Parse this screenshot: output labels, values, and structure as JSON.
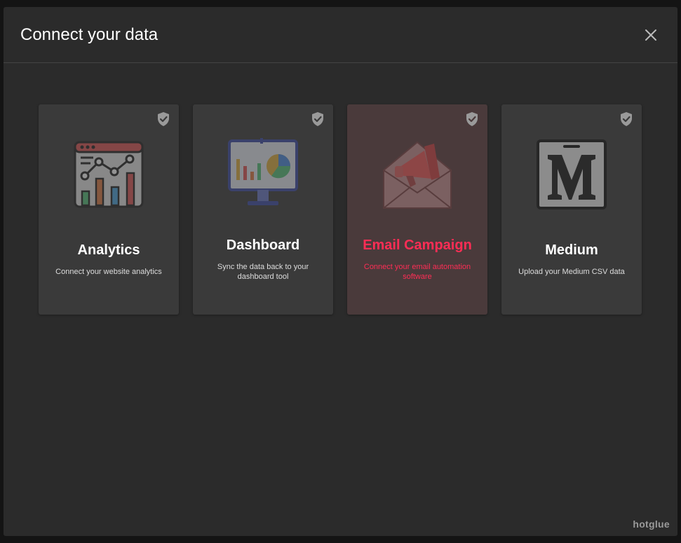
{
  "modal": {
    "title": "Connect your data",
    "close_icon": "close-icon"
  },
  "cards": [
    {
      "title": "Analytics",
      "description": "Connect your website analytics",
      "icon": "analytics-chart-icon",
      "badge_icon": "shield-check-icon",
      "selected": false
    },
    {
      "title": "Dashboard",
      "description": "Sync the data back to your dashboard tool",
      "icon": "dashboard-monitor-icon",
      "badge_icon": "shield-check-icon",
      "selected": false
    },
    {
      "title": "Email Campaign",
      "description": "Connect your email automation software",
      "icon": "email-megaphone-icon",
      "badge_icon": "shield-check-icon",
      "selected": true
    },
    {
      "title": "Medium",
      "description": "Upload your Medium CSV data",
      "icon": "medium-logo-icon",
      "badge_icon": "shield-check-icon",
      "selected": false
    }
  ],
  "footer": {
    "brand": "hotglue"
  },
  "colors": {
    "modal_bg": "#2b2b2b",
    "card_bg": "#3a3a3a",
    "card_selected_bg": "#4a3a3b",
    "accent": "#ff2d55"
  }
}
